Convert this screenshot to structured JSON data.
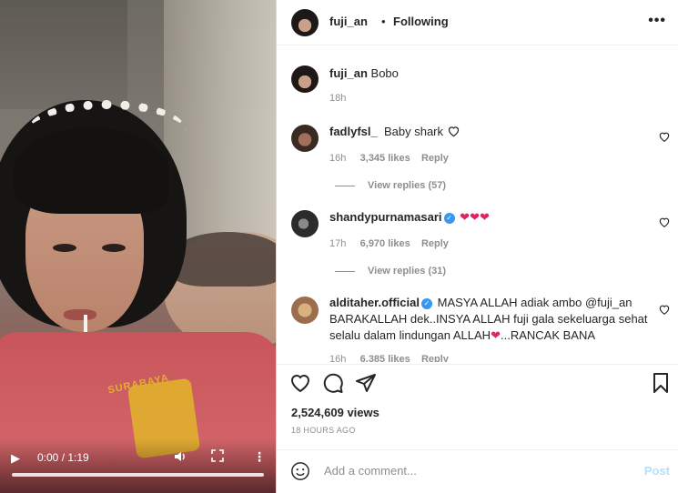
{
  "video": {
    "time": "0:00 / 1:19",
    "progress": 0.0,
    "shirt_print": "SURABAYA"
  },
  "header": {
    "username": "fuji_an",
    "separator": "•",
    "follow_status": "Following",
    "menu_icon": "more-horizontal-icon"
  },
  "caption": {
    "username": "fuji_an",
    "text": "Bobo",
    "time": "18h"
  },
  "comments": [
    {
      "username": "fadlyfsl_",
      "text": "Baby shark",
      "time": "16h",
      "likes": "3,345 likes",
      "reply": "Reply",
      "view_replies": "View replies (57)"
    },
    {
      "username": "shandypurnamasari",
      "verified": true,
      "text": "❤❤❤",
      "time": "17h",
      "likes": "6,970 likes",
      "reply": "Reply",
      "view_replies": "View replies (31)"
    },
    {
      "username": "alditaher.official",
      "verified": true,
      "text_line1": "MASYA ALLAH adiak ambo @fuji_an",
      "text_line2": "BARAKALLAH dek..INSYA ALLAH fuji gala sekeluarga sehat",
      "text_line3": "selalu dalam lindungan ALLAH",
      "text_line3_heart": "❤",
      "text_line3_tail": "...RANCAK BANA",
      "time": "16h",
      "likes": "6,385 likes",
      "reply": "Reply"
    }
  ],
  "stats": {
    "views": "2,524,609 views",
    "posted": "18 HOURS AGO"
  },
  "add_comment": {
    "placeholder": "Add a comment...",
    "post_label": "Post"
  },
  "colors": {
    "accent": "#3897f0",
    "post_disabled": "#b2dffc",
    "heart_red": "#e0245e"
  }
}
